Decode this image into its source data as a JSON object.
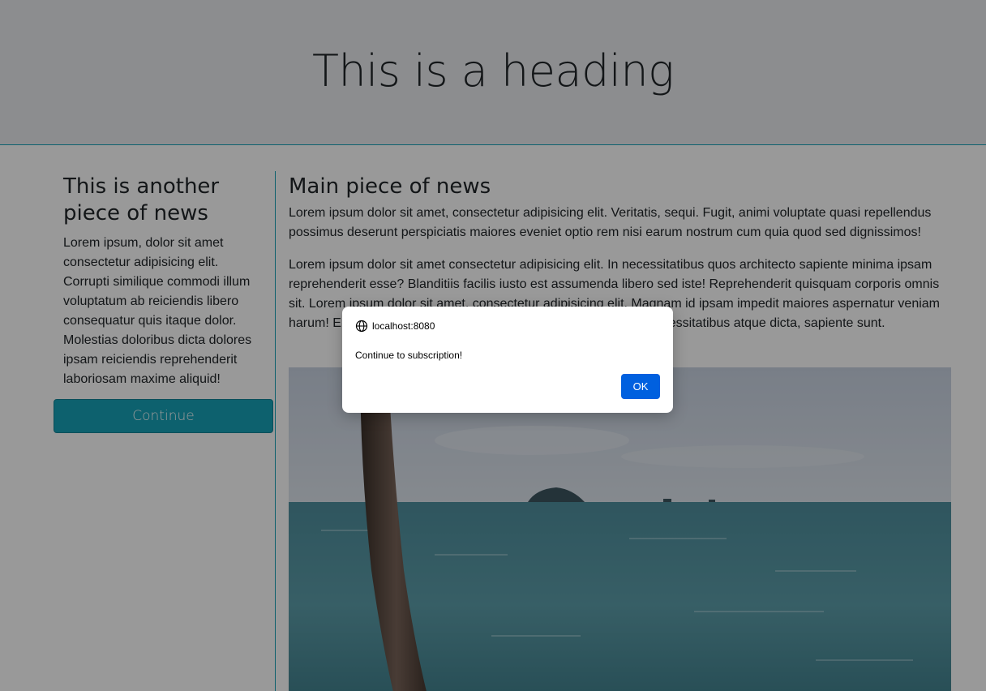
{
  "header": {
    "title": "This is a heading"
  },
  "sidebar": {
    "title": "This is another piece of news",
    "body": "Lorem ipsum, dolor sit amet consectetur adipisicing elit. Corrupti similique commodi illum voluptatum ab reiciendis libero consequatur quis itaque dolor. Molestias doloribus dicta dolores ipsam reiciendis reprehenderit laboriosam maxime aliquid!",
    "button_label": "Continue"
  },
  "main": {
    "title": "Main piece of news",
    "paragraph1": "Lorem ipsum dolor sit amet, consectetur adipisicing elit. Veritatis, sequi. Fugit, animi voluptate quasi repellendus possimus deserunt perspiciatis maiores eveniet optio rem nisi earum nostrum cum quia quod sed dignissimos!",
    "paragraph2": "Lorem ipsum dolor sit amet consectetur adipisicing elit. In necessitatibus quos architecto sapiente minima ipsam reprehenderit esse? Blanditiis facilis iusto est assumenda libero sed iste! Reprehenderit quisquam corporis omnis sit. Lorem ipsum dolor sit amet, consectetur adipisicing elit. Magnam id ipsam impedit maiores aspernatur veniam harum! Error, dolores quidem? Voluptate dolorum pariatur eos necessitatibus atque dicta, sapiente sunt."
  },
  "dialog": {
    "origin": "localhost:8080",
    "message": "Continue to subscription!",
    "ok_label": "OK",
    "icon": "globe-icon"
  },
  "colors": {
    "accent": "#17a2b8",
    "dialog_button": "#0060df",
    "header_bg": "#e9ecef"
  }
}
